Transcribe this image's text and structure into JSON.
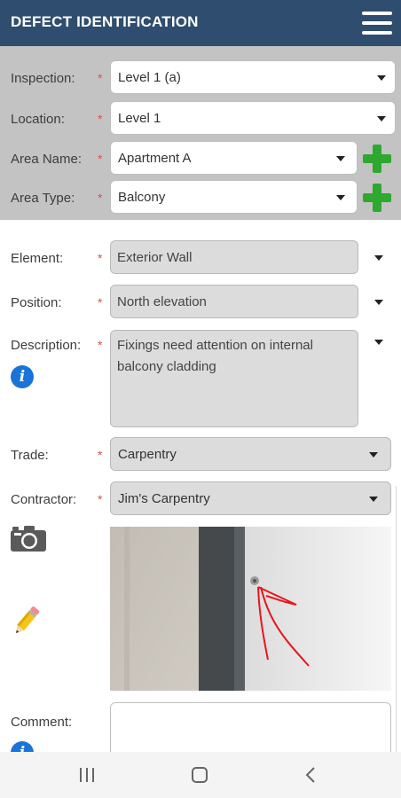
{
  "header": {
    "title": "DEFECT IDENTIFICATION",
    "menu_icon": "hamburger-menu-icon"
  },
  "top_panel": {
    "inspection": {
      "label": "Inspection:",
      "required": "*",
      "value": "Level 1 (a)"
    },
    "location": {
      "label": "Location:",
      "required": "*",
      "value": "Level 1"
    },
    "area_name": {
      "label": "Area Name:",
      "required": "*",
      "value": "Apartment A",
      "add_icon": "plus-icon"
    },
    "area_type": {
      "label": "Area Type:",
      "required": "*",
      "value": "Balcony",
      "add_icon": "plus-icon"
    }
  },
  "form": {
    "element": {
      "label": "Element:",
      "required": "*",
      "value": "Exterior Wall"
    },
    "position": {
      "label": "Position:",
      "required": "*",
      "value": "North elevation"
    },
    "description": {
      "label": "Description:",
      "required": "*",
      "value_line1": "Fixings need attention on internal",
      "value_line2": "balcony cladding",
      "info_icon": "i"
    },
    "trade": {
      "label": "Trade:",
      "required": "*",
      "value": "Carpentry"
    },
    "contractor": {
      "label": "Contractor:",
      "required": "*",
      "value": "Jim's Carpentry"
    },
    "photo": {
      "camera_icon": "camera-icon",
      "edit_icon": "pencil-icon"
    },
    "comment": {
      "label": "Comment:",
      "value": "",
      "info_icon": "i"
    }
  },
  "navbar": {
    "recents": "recent-apps-icon",
    "home": "home-icon",
    "back": "back-icon"
  },
  "colors": {
    "header": "#2f4d6e",
    "panel": "#c3c3c3",
    "required": "#d9534f",
    "plus": "#2ea82e",
    "info": "#1a73d9",
    "annotation": "#e8151c"
  }
}
